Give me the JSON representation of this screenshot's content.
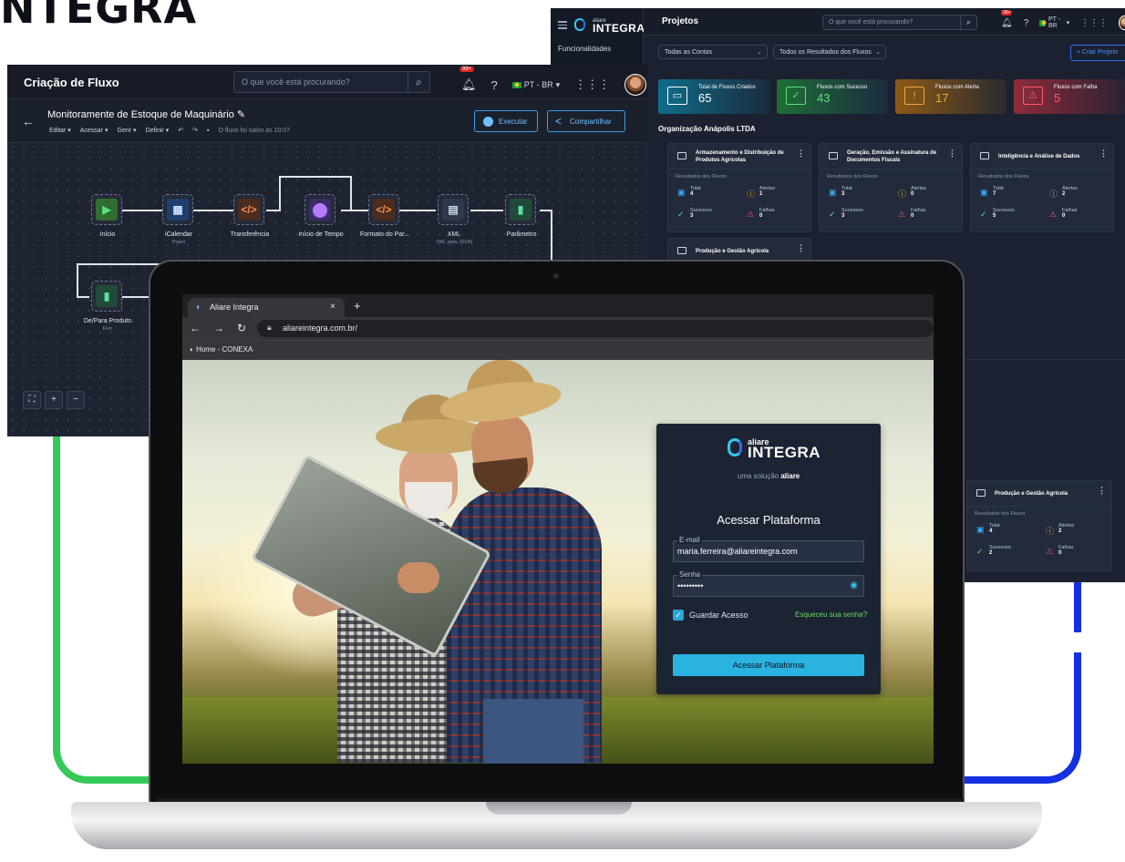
{
  "brand": {
    "top_wordmark": "NTEGRA"
  },
  "dashboard": {
    "logo_small": "aliare",
    "logo_big": "INTEGRA",
    "side_item": "Funcionalidades",
    "title": "Projetos",
    "search_placeholder": "O que você está procurando?",
    "badge": "99+",
    "lang": "PT - BR",
    "filters": [
      "Todas as Contas",
      "Todos os Resultados dos Fluxos"
    ],
    "create_label": "+ Criar Projeto",
    "stats": [
      {
        "label": "Total de Fluxos Criados",
        "value": "65"
      },
      {
        "label": "Fluxos com Sucesso",
        "value": "43"
      },
      {
        "label": "Fluxos com Alerta",
        "value": "17"
      },
      {
        "label": "Fluxos com Falha",
        "value": "5"
      }
    ],
    "org": "Organização Anápolis LTDA",
    "results_label": "Resultados dos Fluxos",
    "metric_labels": {
      "total": "Total",
      "alerts": "Alertas",
      "success": "Sucessos",
      "fail": "Falhas"
    },
    "cards": [
      {
        "title": "Armazenamento e Distribuição de Produtos Agrícolas",
        "total": "4",
        "alerts": "1",
        "success": "3",
        "fail": "0"
      },
      {
        "title": "Geração, Emissão e Assinatura de Documentos Fiscais",
        "total": "3",
        "alerts": "0",
        "success": "3",
        "fail": "0"
      },
      {
        "title": "Inteligência e Análise de Dados",
        "total": "7",
        "alerts": "2",
        "success": "5",
        "fail": "0"
      },
      {
        "title": "Produção e Gestão Agrícola"
      },
      {
        "title": "Produção e Gestão Agrícola",
        "total": "4",
        "alerts": "2",
        "success": "2",
        "fail": "0"
      }
    ]
  },
  "flow": {
    "title": "Criação de Fluxo",
    "search_placeholder": "O que você está procurando?",
    "badge": "99+",
    "lang": "PT - BR",
    "flow_name": "Monitoramente de Estoque de Maquinário",
    "menus": [
      "Editar ▾",
      "Acessar ▾",
      "Gerir ▾",
      "Definir ▾"
    ],
    "saved": "O fluxo foi salvo às 10:07",
    "execute": "Executar",
    "share": "Compartilhar",
    "nodes": [
      {
        "label": "Início",
        "sub": ""
      },
      {
        "label": "iCalendar",
        "sub": "Prazo"
      },
      {
        "label": "Transferência",
        "sub": ""
      },
      {
        "label": "Início de Tempo",
        "sub": ""
      },
      {
        "label": "Formato do Par...",
        "sub": ""
      },
      {
        "label": "XML",
        "sub": "XML para JSON"
      },
      {
        "label": "Parâmetro",
        "sub": ""
      },
      {
        "label": "De/Para Produto",
        "sub": "Fixo"
      }
    ]
  },
  "browser": {
    "tab_title": "Aliare Integra",
    "url": "aliareintegra.com.br/",
    "bookmark": "Home - CONEXA"
  },
  "login": {
    "logo_small": "aliare",
    "logo_big": "INTEGRA",
    "tagline_prefix": "uma solução",
    "tagline_brand": "aliare",
    "heading": "Acessar Plataforma",
    "email_label": "E-mail",
    "email_value": "maria.ferreira@aliareintegra.com",
    "password_label": "Senha",
    "password_value": "•••••••••",
    "remember": "Guardar Acesso",
    "forgot": "Esqueceu sua senha?",
    "submit": "Acessar Plataforma"
  },
  "colors": {
    "accent": "#2ab3e0",
    "green_line": "#35c95a",
    "blue_line": "#1530e0",
    "bg_dark": "#1c2333"
  }
}
